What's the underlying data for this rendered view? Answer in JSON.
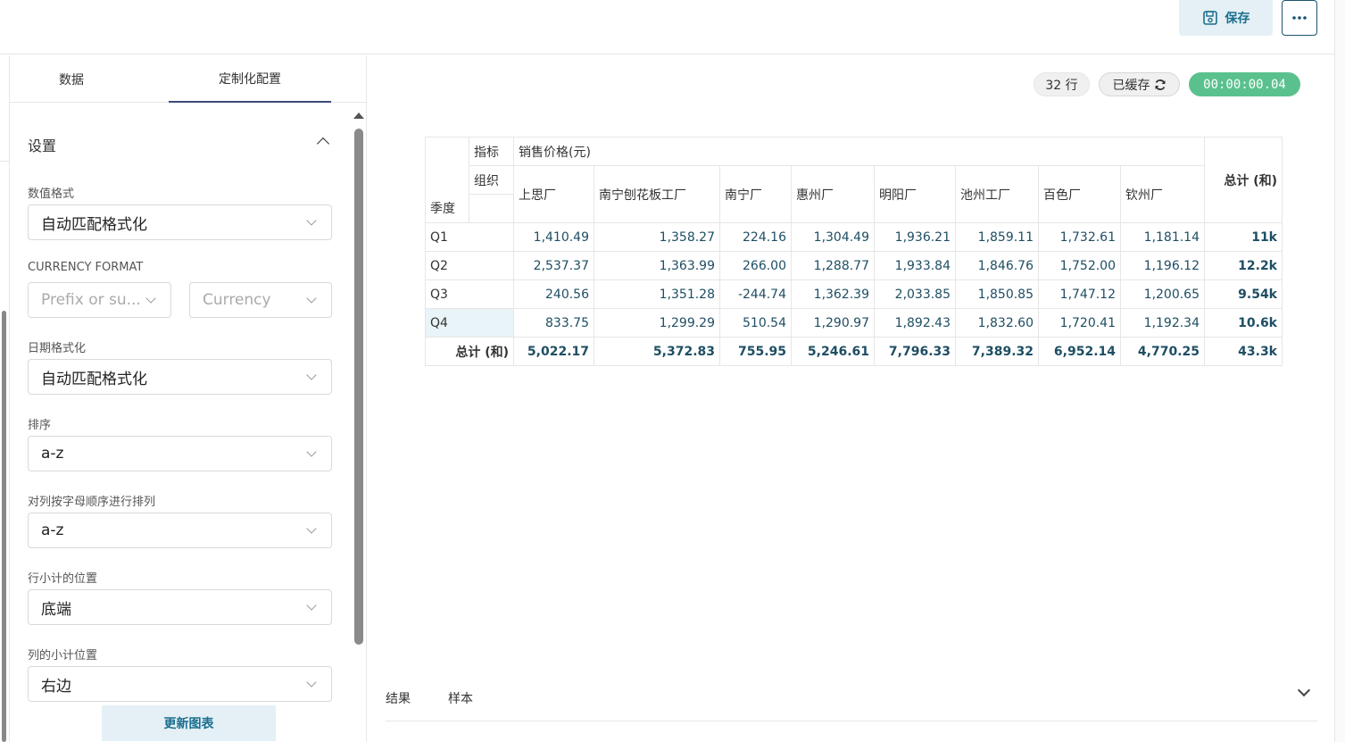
{
  "toolbar": {
    "save_label": "保存",
    "more_label": "···"
  },
  "sidebar": {
    "tabs": [
      {
        "label": "数据"
      },
      {
        "label": "定制化配置"
      }
    ],
    "section_title": "设置",
    "fields": {
      "number_format": {
        "label": "数值格式",
        "value": "自动匹配格式化"
      },
      "currency_format": {
        "label": "CURRENCY FORMAT",
        "prefix_placeholder": "Prefix or su...",
        "currency_placeholder": "Currency"
      },
      "date_format": {
        "label": "日期格式化",
        "value": "自动匹配格式化"
      },
      "sort": {
        "label": "排序",
        "value": "a-z"
      },
      "column_sort": {
        "label": "对列按字母顺序进行排列",
        "value": "a-z"
      },
      "row_subtotal": {
        "label": "行小计的位置",
        "value": "底端"
      },
      "column_subtotal": {
        "label": "列的小计位置",
        "value": "右边"
      }
    },
    "update_label": "更新图表"
  },
  "main": {
    "rows_badge": "32 行",
    "cached_badge": "已缓存",
    "timer_badge": "00:00:00.04",
    "bottom_tabs": [
      {
        "label": "结果"
      },
      {
        "label": "样本"
      }
    ]
  },
  "chart_data": {
    "type": "table",
    "metric_label": "指标",
    "metric": "销售价格(元)",
    "column_dim_label": "组织",
    "row_dim_label": "季度",
    "total_header": "总计 (和)",
    "columns": [
      "上思厂",
      "南宁刨花板工厂",
      "南宁厂",
      "惠州厂",
      "明阳厂",
      "池州工厂",
      "百色厂",
      "钦州厂"
    ],
    "rows": [
      {
        "label": "Q1",
        "values": [
          "1,410.49",
          "1,358.27",
          "224.16",
          "1,304.49",
          "1,936.21",
          "1,859.11",
          "1,732.61",
          "1,181.14"
        ],
        "total": "11k"
      },
      {
        "label": "Q2",
        "values": [
          "2,537.37",
          "1,363.99",
          "266.00",
          "1,288.77",
          "1,933.84",
          "1,846.76",
          "1,752.00",
          "1,196.12"
        ],
        "total": "12.2k"
      },
      {
        "label": "Q3",
        "values": [
          "240.56",
          "1,351.28",
          "-244.74",
          "1,362.39",
          "2,033.85",
          "1,850.85",
          "1,747.12",
          "1,200.65"
        ],
        "total": "9.54k"
      },
      {
        "label": "Q4",
        "values": [
          "833.75",
          "1,299.29",
          "510.54",
          "1,290.97",
          "1,892.43",
          "1,832.60",
          "1,720.41",
          "1,192.34"
        ],
        "total": "10.6k"
      }
    ],
    "total_row": {
      "label": "总计 (和)",
      "values": [
        "5,022.17",
        "5,372.83",
        "755.95",
        "5,246.61",
        "7,796.33",
        "7,389.32",
        "6,952.14",
        "4,770.25"
      ],
      "total": "43.3k"
    }
  }
}
